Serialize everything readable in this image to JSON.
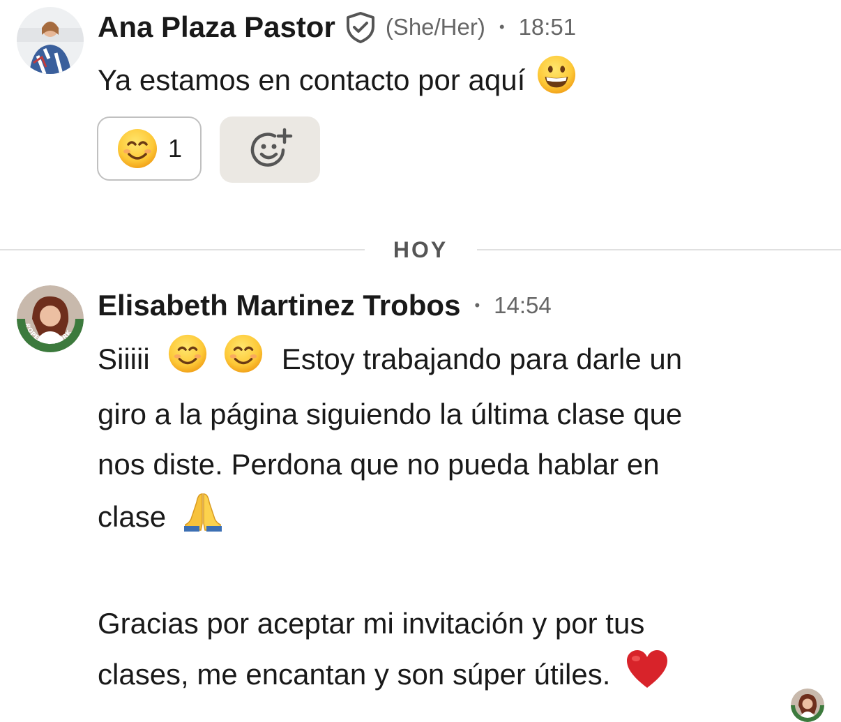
{
  "messages": [
    {
      "author": "Ana Plaza Pastor",
      "verified": true,
      "pronouns": "(She/Her)",
      "separator": "•",
      "time": "18:51",
      "text": "Ya estamos en contacto por aquí",
      "trailing_emoji": "grinning-face",
      "reactions": [
        {
          "emoji": "smiling-face",
          "count": "1"
        }
      ]
    },
    {
      "author": "Elisabeth Martinez Trobos",
      "separator": "•",
      "time": "14:54",
      "avatar_badge": "#OPENTOWORK",
      "lines": {
        "l1a": "Siiiii",
        "l1b": "Estoy trabajando para darle un",
        "l2": "giro a la página siguiendo la última clase que",
        "l3": "nos diste. Perdona que no pueda hablar en",
        "l4": "clase",
        "l5": "Gracias por aceptar mi invitación y por tus",
        "l6": "clases, me encantan y son súper útiles."
      },
      "emojis": [
        "smiling-face",
        "smiling-face",
        "folded-hands",
        "red-heart"
      ]
    }
  ],
  "date_divider": "HOY",
  "colors": {
    "text": "#191919",
    "muted": "#666666",
    "reaction_add_bg": "#ebe8e3",
    "opentowork_green": "#3c7a3d",
    "heart": "#d8232a",
    "emoji_yellow": "#fdc938"
  }
}
